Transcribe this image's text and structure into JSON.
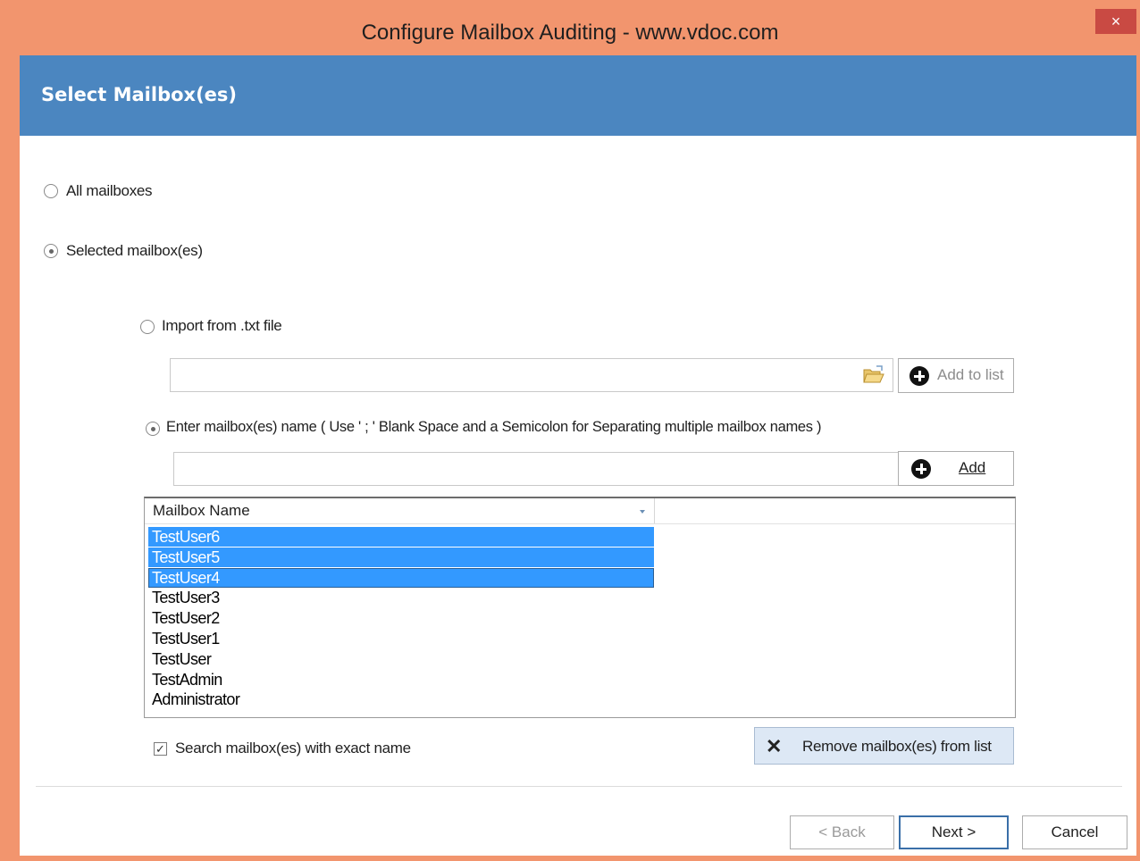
{
  "window": {
    "title": "Configure Mailbox Auditing - www.vdoc.com",
    "close_glyph": "×"
  },
  "header": {
    "title": "Select Mailbox(es)"
  },
  "scope": {
    "all_label": "All mailboxes",
    "selected_label": "Selected mailbox(es)",
    "selected_value": "selected"
  },
  "import": {
    "label": "Import from .txt file",
    "path_value": "",
    "add_to_list_label": "Add to list"
  },
  "enter": {
    "label": "Enter mailbox(es) name ( Use ' ; ' Blank Space and a Semicolon for Separating multiple mailbox names )",
    "name_value": "",
    "add_label": "Add"
  },
  "grid": {
    "column_header": "Mailbox Name",
    "rows": [
      {
        "name": "TestUser6",
        "selected": true
      },
      {
        "name": "TestUser5",
        "selected": true
      },
      {
        "name": "TestUser4",
        "selected": true,
        "focused": true
      },
      {
        "name": "TestUser3",
        "selected": false
      },
      {
        "name": "TestUser2",
        "selected": false
      },
      {
        "name": "TestUser1",
        "selected": false
      },
      {
        "name": "TestUser",
        "selected": false
      },
      {
        "name": "TestAdmin",
        "selected": false
      },
      {
        "name": "Administrator",
        "selected": false
      }
    ]
  },
  "exact": {
    "label": "Search mailbox(es) with exact name",
    "checked": true,
    "check_glyph": "✓"
  },
  "remove": {
    "label": "Remove mailbox(es) from list",
    "icon_glyph": "✕"
  },
  "nav": {
    "back_label": "< Back",
    "next_label": "Next >",
    "cancel_label": "Cancel"
  },
  "colors": {
    "accent": "#4b86c0",
    "frame": "#f2956e",
    "selection": "#3399ff",
    "close": "#c94a43"
  },
  "icons": [
    "close-icon",
    "folder-open-icon",
    "plus-circle-icon",
    "dropdown-arrow-icon",
    "x-icon",
    "checkmark-icon"
  ]
}
